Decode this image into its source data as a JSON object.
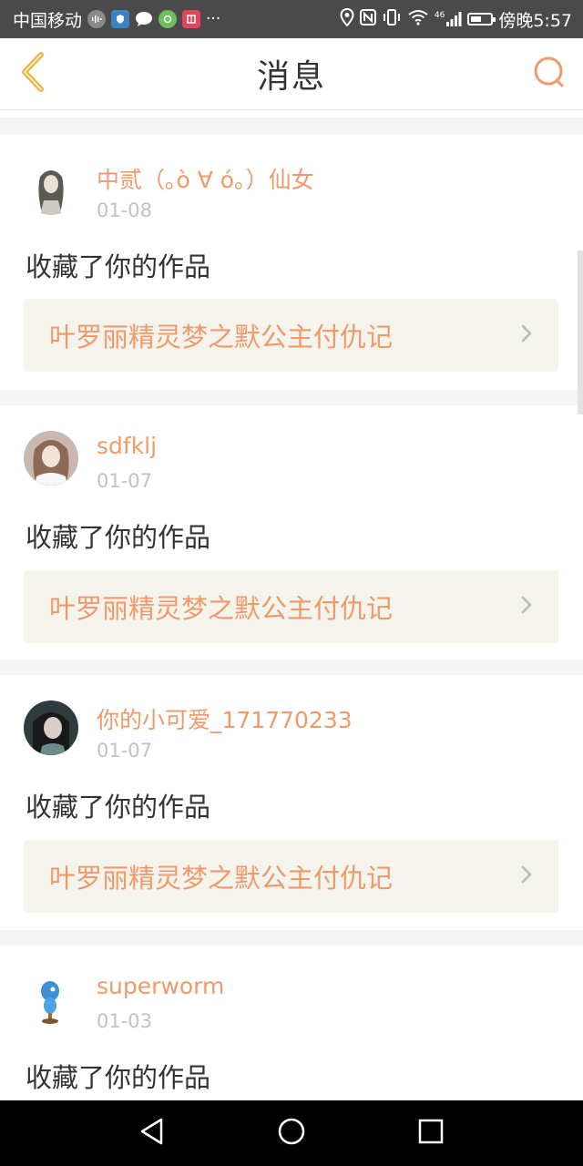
{
  "status_bar": {
    "carrier": "中国移动",
    "network_badge": "46",
    "time": "傍晚5:57",
    "icons": [
      "voice-icon",
      "shield-app-icon",
      "chat-icon",
      "camera-app-icon",
      "book-app-icon",
      "more-dots-icon",
      "location-icon",
      "nfc-icon",
      "vibrate-icon",
      "wifi-icon",
      "signal-icon",
      "battery-icon"
    ]
  },
  "header": {
    "title": "消息",
    "back_icon": "chevron-left-icon",
    "search_icon": "search-icon"
  },
  "messages": [
    {
      "user": "中贰（｡ò ∀ ó｡）仙女",
      "date": "01-08",
      "action": "收藏了你的作品",
      "work": "叶罗丽精灵梦之默公主付仇记"
    },
    {
      "user": "sdfklj",
      "date": "01-07",
      "action": "收藏了你的作品",
      "work": "叶罗丽精灵梦之默公主付仇记"
    },
    {
      "user": "你的小可爱_171770233",
      "date": "01-07",
      "action": "收藏了你的作品",
      "work": "叶罗丽精灵梦之默公主付仇记"
    },
    {
      "user": "superworm",
      "date": "01-03",
      "action": "收藏了你的作品"
    }
  ],
  "colors": {
    "accent": "#ef9a6a",
    "status_bar": "#4a4a4a",
    "link_box": "#f4f4ec",
    "date": "#c2c2c2"
  },
  "nav_bar": {
    "icons": [
      "back-triangle-icon",
      "home-circle-icon",
      "recents-square-icon"
    ]
  }
}
